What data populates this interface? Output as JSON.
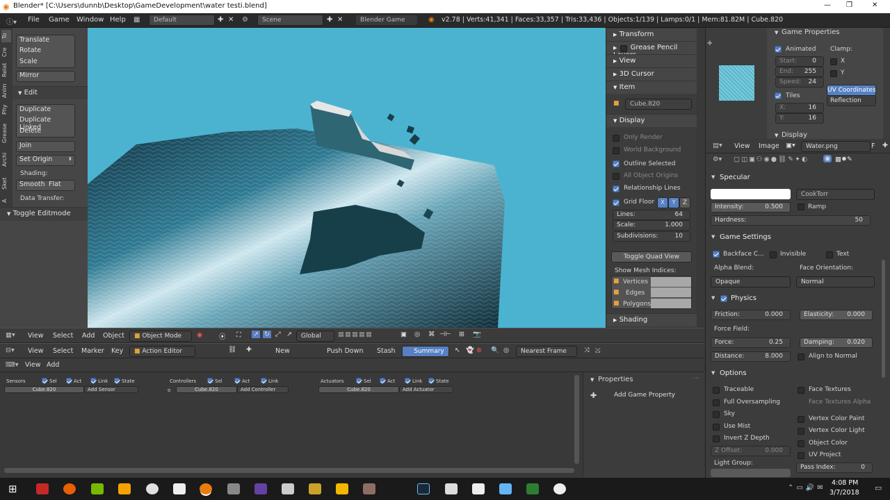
{
  "titlebar": {
    "title": "Blender* [C:\\Users\\dunnb\\Desktop\\GameDevelopment\\water testi.blend]",
    "min": "—",
    "max": "❐",
    "close": "✕"
  },
  "menubar": {
    "file": "File",
    "game": "Game",
    "window": "Window",
    "help": "Help",
    "screen": "Default",
    "scene": "Scene",
    "engine": "Blender Game",
    "stats": "v2.78 | Verts:41,341 | Faces:33,357 | Tris:33,436 | Objects:1/139 | Lamps:0/1 | Mem:81.82M | Cube.820"
  },
  "toolshelf": {
    "tabs": [
      "To",
      "Cre",
      "Relat",
      "Anim",
      "Phy",
      "Grease",
      "Archi",
      "Sket",
      "A"
    ],
    "transform": [
      "Translate",
      "Rotate",
      "Scale"
    ],
    "mirror": "Mirror",
    "edit_header": "Edit",
    "edit": [
      "Duplicate",
      "Duplicate Linked",
      "Delete"
    ],
    "join": "Join",
    "set_origin": "Set Origin",
    "shading_label": "Shading:",
    "smooth": "Smooth",
    "flat": "Flat",
    "data_transfer": "Data Transfer:",
    "toggle_editmode": "Toggle Editmode"
  },
  "npanel": {
    "transform": "Transform",
    "grease": "Grease Pencil Layers",
    "view": "View",
    "cursor": "3D Cursor",
    "item": "Item",
    "item_name": "Cube.820",
    "display": "Display",
    "only_render": "Only Render",
    "world_bg": "World Background",
    "outline": "Outline Selected",
    "all_origins": "All Object Origins",
    "relationship": "Relationship Lines",
    "grid_floor": "Grid Floor",
    "axes": [
      "X",
      "Y",
      "Z"
    ],
    "lines_label": "Lines:",
    "lines_val": "64",
    "scale_label": "Scale:",
    "scale_val": "1.000",
    "subdiv_label": "Subdivisions:",
    "subdiv_val": "10",
    "toggle_quad": "Toggle Quad View",
    "mesh_indices": "Show Mesh Indices:",
    "vertices": "Vertices",
    "edges": "Edges",
    "polygons": "Polygons",
    "shading": "Shading"
  },
  "view3d_header": {
    "view": "View",
    "select": "Select",
    "add": "Add",
    "object": "Object",
    "mode": "Object Mode",
    "orientation": "Global"
  },
  "action_header": {
    "view": "View",
    "select": "Select",
    "marker": "Marker",
    "key": "Key",
    "editor": "Action Editor",
    "new": "New",
    "push_down": "Push Down",
    "stash": "Stash",
    "summary": "Summary",
    "snap": "Nearest Frame"
  },
  "logic": {
    "view": "View",
    "add": "Add",
    "sensors": "Sensors",
    "controllers": "Controllers",
    "actuators": "Actuators",
    "sel": "Sel",
    "act": "Act",
    "link": "Link",
    "state": "State",
    "obj": "Cube.820",
    "add_sensor": "Add Sensor",
    "add_controller": "Add Controller",
    "add_actuator": "Add Actuator",
    "properties": "Properties",
    "add_prop": "Add Game Property"
  },
  "image_props": {
    "header": "Game Properties",
    "animated": "Animated",
    "clamp": "Clamp:",
    "start_label": "Start:",
    "start": "0",
    "end_label": "End:",
    "end": "255",
    "speed_label": "Speed:",
    "speed": "24",
    "x": "X",
    "y": "Y",
    "tiles": "Tiles",
    "uv_coords": "UV Coordinates",
    "reflection": "Reflection",
    "tx_label": "X:",
    "tx": "16",
    "ty_label": "Y:",
    "ty": "16",
    "display": "Display",
    "view": "View",
    "image": "Image",
    "image_name": "Water.png",
    "fake": "F"
  },
  "material": {
    "specular": "Specular",
    "spec_shader": "CookTorr",
    "intensity_label": "Intensity:",
    "intensity": "0.500",
    "ramp": "Ramp",
    "hardness_label": "Hardness:",
    "hardness": "50",
    "game_settings": "Game Settings",
    "backface": "Backface C...",
    "invisible": "Invisible",
    "text": "Text",
    "alpha_blend": "Alpha Blend:",
    "face_orient": "Face Orientation:",
    "opaque": "Opaque",
    "normal": "Normal",
    "physics": "Physics",
    "friction_label": "Friction:",
    "friction": "0.000",
    "elasticity_label": "Elasticity:",
    "elasticity": "0.000",
    "force_field": "Force Field:",
    "force_label": "Force:",
    "force": "0.25",
    "damping_label": "Damping:",
    "damping": "0.020",
    "distance_label": "Distance:",
    "distance": "8.000",
    "align_normal": "Align to Normal",
    "options": "Options",
    "traceable": "Traceable",
    "face_textures": "Face Textures",
    "full_os": "Full Oversampling",
    "face_tex_alpha": "Face Textures Alpha",
    "sky": "Sky",
    "vcol_paint": "Vertex Color Paint",
    "use_mist": "Use Mist",
    "vcol_light": "Vertex Color Light",
    "invert_z": "Invert Z Depth",
    "object_color": "Object Color",
    "zoffset_label": "Z Offset:",
    "zoffset": "0.000",
    "uv_project": "UV Project",
    "light_group": "Light Group:",
    "pass_index_label": "Pass Index:",
    "pass_index": "0"
  },
  "taskbar": {
    "time": "4:08 PM",
    "date": "3/7/2018"
  }
}
